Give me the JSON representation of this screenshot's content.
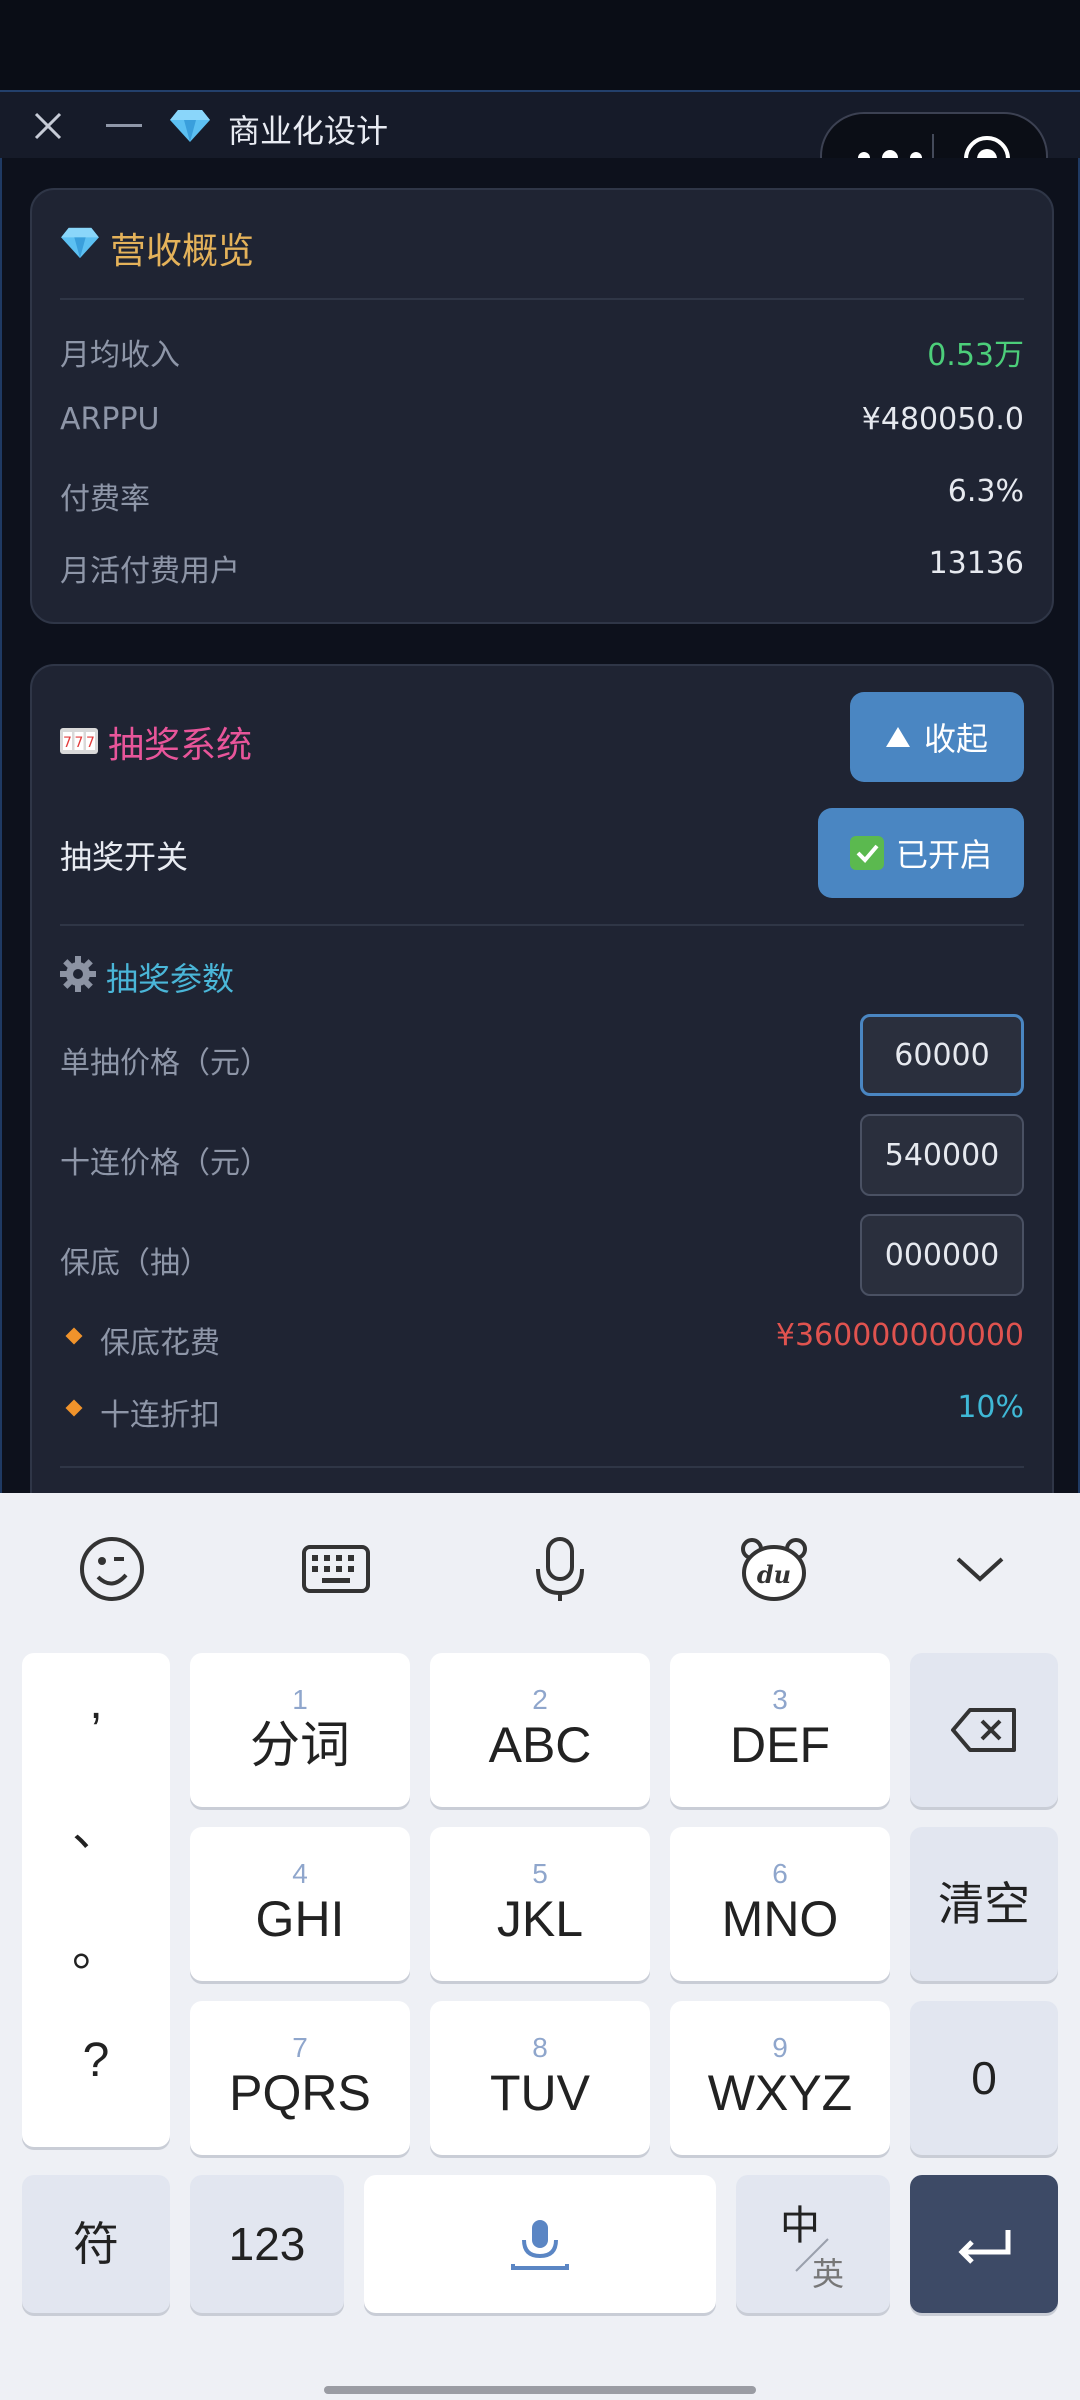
{
  "header": {
    "title": "商业化设计"
  },
  "revenue": {
    "title": "营收概览",
    "rows": [
      {
        "label": "月均收入",
        "value": "0.53万",
        "color": "#4cce7a"
      },
      {
        "label": "ARPPU",
        "value": "¥480050.0",
        "color": "#e6e9ef"
      },
      {
        "label": "付费率",
        "value": "6.3%",
        "color": "#e6e9ef"
      },
      {
        "label": "月活付费用户",
        "value": "13136",
        "color": "#e6e9ef"
      }
    ]
  },
  "lottery": {
    "title": "抽奖系统",
    "collapse_label": "收起",
    "switch_label": "抽奖开关",
    "switch_state": "已开启",
    "params_title": "抽奖参数",
    "params": [
      {
        "label": "单抽价格（元）",
        "value": "60000"
      },
      {
        "label": "十连价格（元）",
        "value": "540000"
      },
      {
        "label": "保底（抽）",
        "value": "000000"
      }
    ],
    "stats": [
      {
        "label": "保底花费",
        "value": "¥360000000000",
        "color": "#e0534f"
      },
      {
        "label": "十连折扣",
        "value": "10%",
        "color": "#3fb8d6"
      }
    ]
  },
  "keyboard": {
    "punct": [
      ",",
      "、",
      "。",
      "?"
    ],
    "keys": [
      {
        "num": "1",
        "label": "分词"
      },
      {
        "num": "2",
        "label": "ABC"
      },
      {
        "num": "3",
        "label": "DEF"
      },
      {
        "num": "4",
        "label": "GHI"
      },
      {
        "num": "5",
        "label": "JKL"
      },
      {
        "num": "6",
        "label": "MNO"
      },
      {
        "num": "7",
        "label": "PQRS"
      },
      {
        "num": "8",
        "label": "TUV"
      },
      {
        "num": "9",
        "label": "WXYZ"
      }
    ],
    "clear": "清空",
    "zero": "0",
    "symbol": "符",
    "numeric": "123",
    "lang_top": "中",
    "lang_bottom": "英"
  },
  "colors": {
    "gold_title": "#e4b25a",
    "pink_title": "#e8559a",
    "cyan_title": "#4ab6d8",
    "accent_blue": "#4a86c2"
  }
}
